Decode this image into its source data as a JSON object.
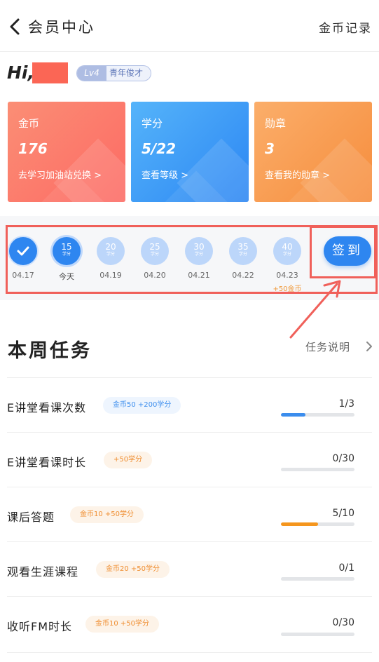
{
  "header": {
    "title": "会员中心",
    "right_link": "金币记录"
  },
  "user": {
    "greeting": "Hi,",
    "level": "Lv4",
    "level_title": "青年俊才"
  },
  "cards": [
    {
      "label": "金币",
      "value": "176",
      "link": "去学习加油站兑换 >",
      "color": "#fc6f65"
    },
    {
      "label": "学分",
      "value": "5/22",
      "link": "查看等级 >",
      "color": "#2c86f3"
    },
    {
      "label": "勋章",
      "value": "3",
      "link": "查看我的勋章 >",
      "color": "#f68d3d"
    }
  ],
  "checkin": {
    "days": [
      {
        "points": "",
        "unit": "",
        "date": "04.17",
        "state": "done",
        "bonus": ""
      },
      {
        "points": "15",
        "unit": "学分",
        "date": "今天",
        "state": "today",
        "bonus": ""
      },
      {
        "points": "20",
        "unit": "学分",
        "date": "04.19",
        "state": "future",
        "bonus": ""
      },
      {
        "points": "25",
        "unit": "学分",
        "date": "04.20",
        "state": "future",
        "bonus": ""
      },
      {
        "points": "30",
        "unit": "学分",
        "date": "04.21",
        "state": "future",
        "bonus": ""
      },
      {
        "points": "35",
        "unit": "学分",
        "date": "04.22",
        "state": "future",
        "bonus": ""
      },
      {
        "points": "40",
        "unit": "学分",
        "date": "04.23",
        "state": "future",
        "bonus": "+50金币"
      }
    ],
    "button_label": "签到"
  },
  "tasks_section": {
    "title": "本周任务",
    "help_link": "任务说明"
  },
  "tasks": [
    {
      "name": "E讲堂看课次数",
      "reward": "金币50 +200学分",
      "reward_style": "blue",
      "progress_text": "1/3",
      "progress": 0.333,
      "bar_color": "#3b8ded"
    },
    {
      "name": "E讲堂看课时长",
      "reward": "+50学分",
      "reward_style": "orange",
      "progress_text": "0/30",
      "progress": 0,
      "bar_color": "#3b8ded"
    },
    {
      "name": "课后答题",
      "reward": "金币10 +50学分",
      "reward_style": "orange",
      "progress_text": "5/10",
      "progress": 0.5,
      "bar_color": "#f5961e"
    },
    {
      "name": "观看生涯课程",
      "reward": "金币20 +50学分",
      "reward_style": "orange",
      "progress_text": "0/1",
      "progress": 0,
      "bar_color": "#3b8ded"
    },
    {
      "name": "收听FM时长",
      "reward": "金币10 +50学分",
      "reward_style": "orange",
      "progress_text": "0/30",
      "progress": 0,
      "bar_color": "#3b8ded"
    }
  ]
}
